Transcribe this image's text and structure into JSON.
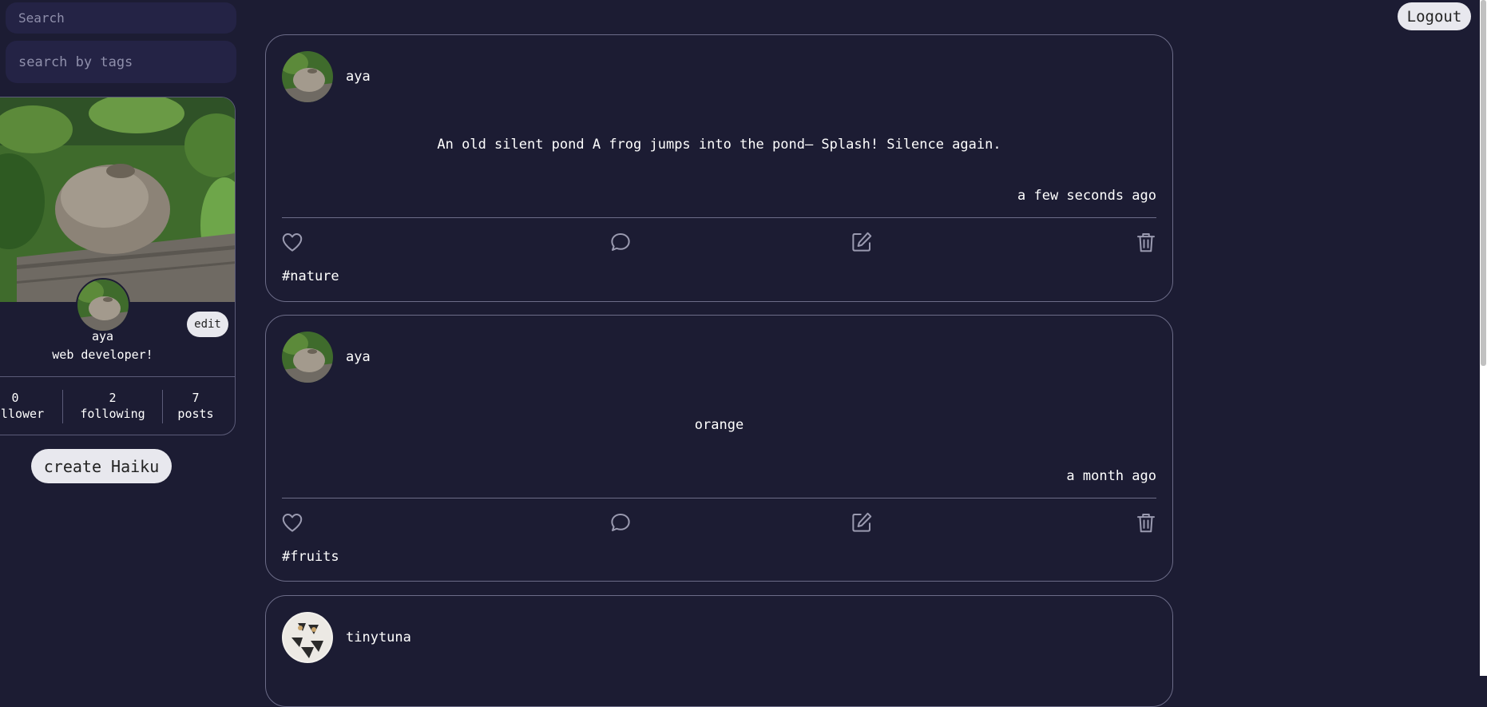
{
  "search": {
    "placeholder": "Search"
  },
  "tag_search": {
    "placeholder": "search by tags"
  },
  "profile": {
    "name": "aya",
    "bio": "web developer!",
    "edit_label": "edit",
    "stats": [
      {
        "value": "0",
        "label": "follower"
      },
      {
        "value": "2",
        "label": "following"
      },
      {
        "value": "7",
        "label": "posts"
      }
    ]
  },
  "create_label": "create Haiku",
  "logout_label": "Logout",
  "posts": [
    {
      "user": "aya",
      "content": "An old silent pond A frog jumps into the pond— Splash! Silence again.",
      "time": "a few seconds ago",
      "tag": "#nature"
    },
    {
      "user": "aya",
      "content": "orange",
      "time": "a month ago",
      "tag": "#fruits"
    },
    {
      "user": "tinytuna"
    }
  ]
}
